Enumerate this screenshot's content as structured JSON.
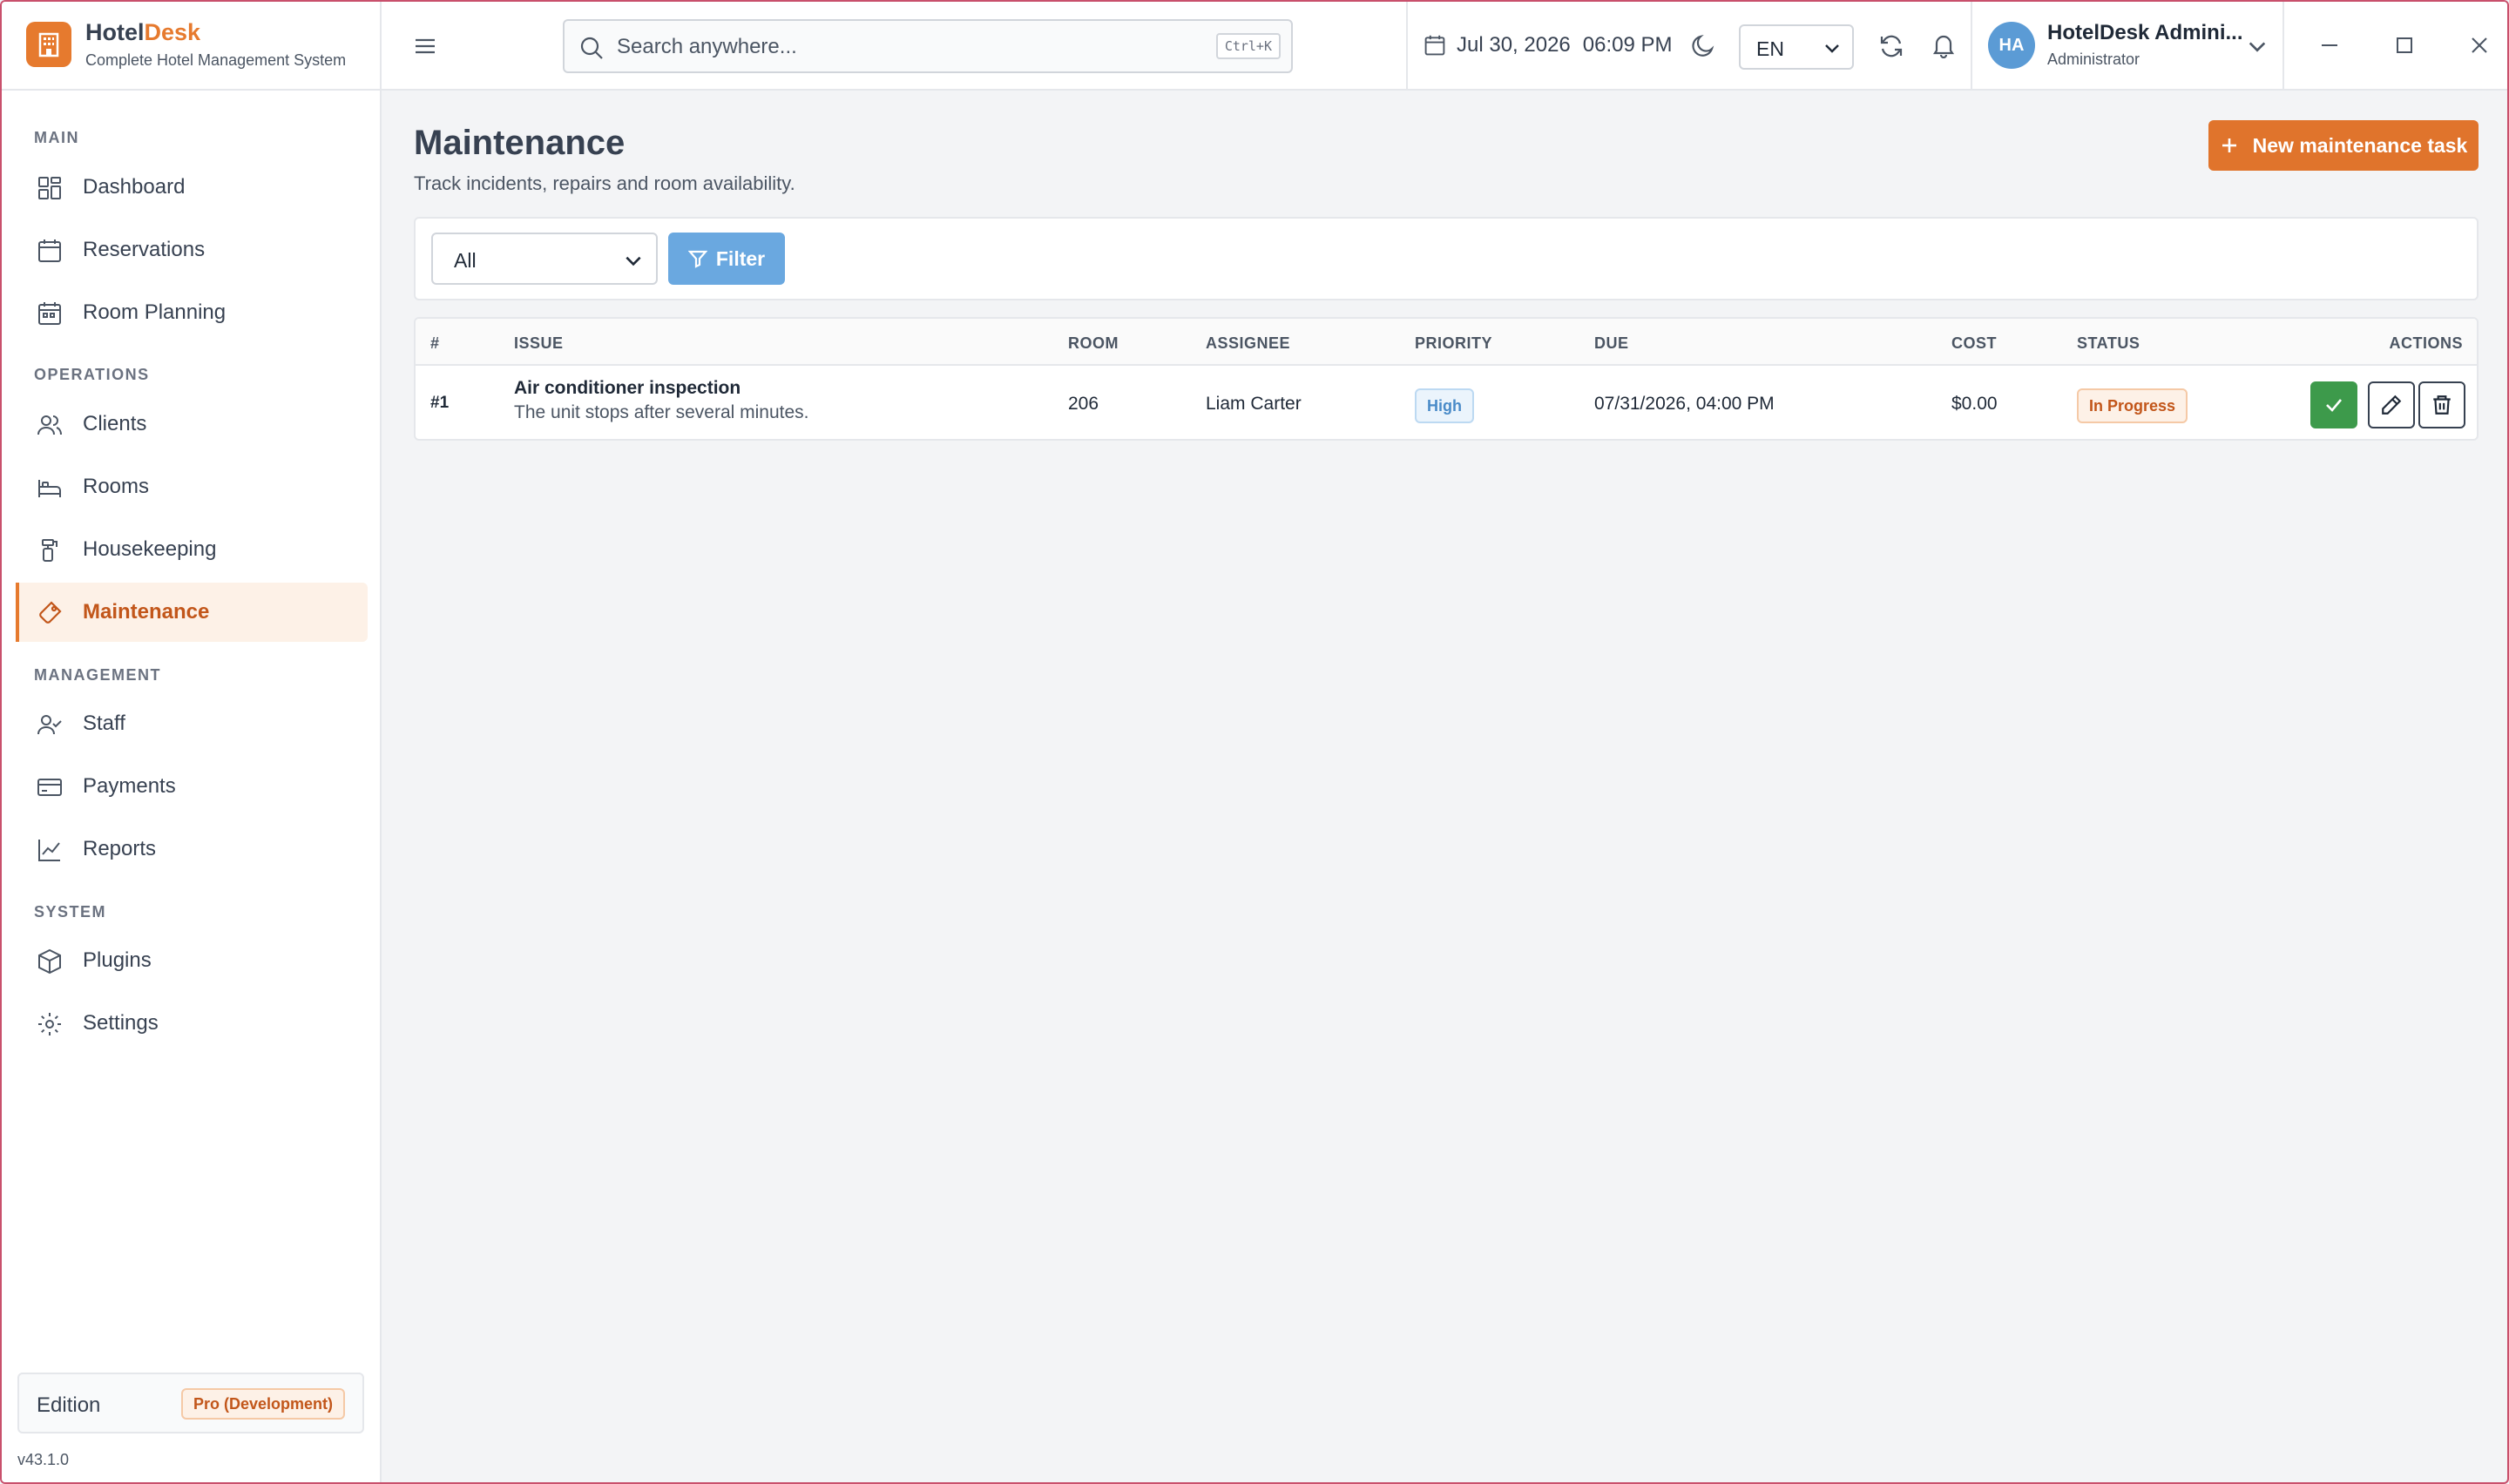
{
  "brand": {
    "name_part1": "Hotel",
    "name_part2": "Desk",
    "subtitle": "Complete Hotel Management System",
    "accent_color": "#e67a2e"
  },
  "sidebar": {
    "sections": [
      {
        "title": "MAIN"
      },
      {
        "title": "OPERATIONS"
      },
      {
        "title": "MANAGEMENT"
      },
      {
        "title": "SYSTEM"
      }
    ],
    "items": [
      {
        "label": "Dashboard",
        "icon": "dashboard-icon"
      },
      {
        "label": "Reservations",
        "icon": "calendar-icon"
      },
      {
        "label": "Room Planning",
        "icon": "calendar-grid-icon"
      },
      {
        "label": "Clients",
        "icon": "users-icon"
      },
      {
        "label": "Rooms",
        "icon": "bed-icon"
      },
      {
        "label": "Housekeeping",
        "icon": "housekeeping-icon"
      },
      {
        "label": "Maintenance",
        "icon": "wrench-icon",
        "active": true
      },
      {
        "label": "Staff",
        "icon": "user-check-icon"
      },
      {
        "label": "Payments",
        "icon": "credit-card-icon"
      },
      {
        "label": "Reports",
        "icon": "line-chart-icon"
      },
      {
        "label": "Plugins",
        "icon": "package-icon"
      },
      {
        "label": "Settings",
        "icon": "gear-icon"
      }
    ],
    "edition_label": "Edition",
    "edition_badge": "Pro (Development)",
    "version": "v43.1.0"
  },
  "topbar": {
    "search_placeholder": "Search anywhere...",
    "search_shortcut": "Ctrl+K",
    "date": "Jul 30, 2026",
    "time": "06:09 PM",
    "language": "EN",
    "user_initials": "HA",
    "user_name": "HotelDesk Admini...",
    "user_role": "Administrator"
  },
  "main": {
    "title": "Maintenance",
    "subtitle": "Track incidents, repairs and room availability.",
    "new_button": "New maintenance task",
    "filter_select": "All",
    "filter_button": "Filter",
    "table": {
      "columns": [
        "#",
        "ISSUE",
        "ROOM",
        "ASSIGNEE",
        "PRIORITY",
        "DUE",
        "COST",
        "STATUS",
        "ACTIONS"
      ],
      "rows": [
        {
          "id": "#1",
          "issue_title": "Air conditioner inspection",
          "issue_desc": "The unit stops after several minutes.",
          "room": "206",
          "assignee": "Liam Carter",
          "priority": "High",
          "due": "07/31/2026, 04:00 PM",
          "cost": "$0.00",
          "status": "In Progress"
        }
      ]
    }
  }
}
